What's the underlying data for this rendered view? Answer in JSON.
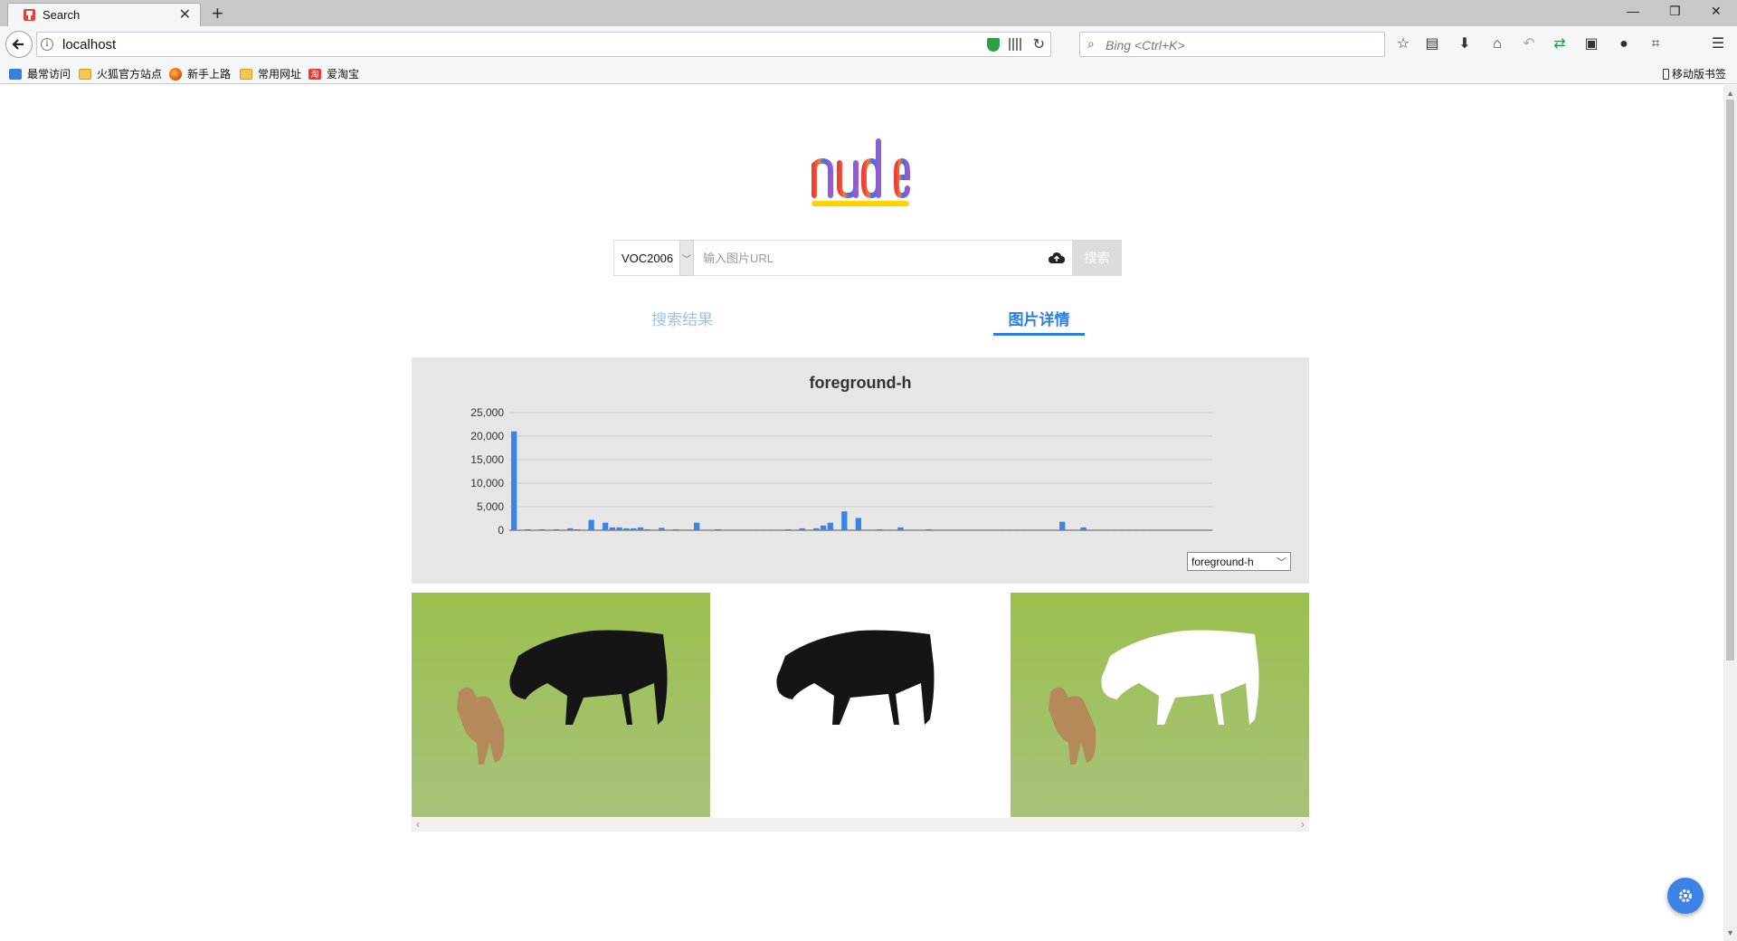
{
  "browser": {
    "tab_title": "Search",
    "url": "localhost",
    "search_placeholder": "Bing <Ctrl+K>",
    "bookmarks": [
      "最常访问",
      "火狐官方站点",
      "新手上路",
      "常用网址",
      "爱淘宝"
    ],
    "mobile_bookmarks": "移动版书签"
  },
  "app": {
    "logo_text": "nudle",
    "dataset_selected": "VOC2006",
    "url_placeholder": "输入图片URL",
    "search_label": "搜索",
    "tabs": [
      {
        "label": "搜索结果",
        "active": false
      },
      {
        "label": "图片详情",
        "active": true
      }
    ],
    "feature_selected": "foreground-h"
  },
  "colors": {
    "accent": "#2e7de1",
    "tab_inactive": "#9ec1f0",
    "bar": "#3d82e6",
    "panel_bg": "#e6e6e6",
    "logo_gradient": [
      "#ef3e36",
      "#f07a3a",
      "#3b6fe0",
      "#9b59d0"
    ],
    "logo_underline": "#ffd400"
  },
  "chart_data": {
    "type": "bar",
    "title": "foreground-h",
    "ylim": [
      0,
      25000
    ],
    "yticks": [
      "25,000",
      "20,000",
      "15,000",
      "10,000",
      "5,000",
      "0"
    ],
    "ytick_values": [
      25000,
      20000,
      15000,
      10000,
      5000,
      0
    ],
    "grid": true,
    "values": [
      21000,
      0,
      150,
      0,
      150,
      0,
      100,
      0,
      400,
      200,
      0,
      2200,
      0,
      1600,
      600,
      600,
      400,
      400,
      600,
      200,
      0,
      500,
      0,
      200,
      0,
      0,
      1600,
      0,
      0,
      200,
      0,
      0,
      0,
      0,
      0,
      0,
      0,
      0,
      0,
      200,
      0,
      400,
      0,
      400,
      1000,
      1600,
      0,
      4000,
      0,
      2600,
      0,
      0,
      200,
      0,
      0,
      600,
      0,
      0,
      0,
      100,
      0,
      0,
      0,
      0,
      0,
      0,
      0,
      0,
      0,
      0,
      0,
      0,
      0,
      0,
      0,
      0,
      0,
      0,
      1800,
      0,
      0,
      600,
      0,
      0,
      0,
      0,
      0,
      0,
      0,
      0,
      0,
      0,
      0,
      0,
      0,
      0,
      0,
      0,
      0,
      0
    ]
  },
  "images": [
    "original",
    "foreground",
    "masked"
  ]
}
